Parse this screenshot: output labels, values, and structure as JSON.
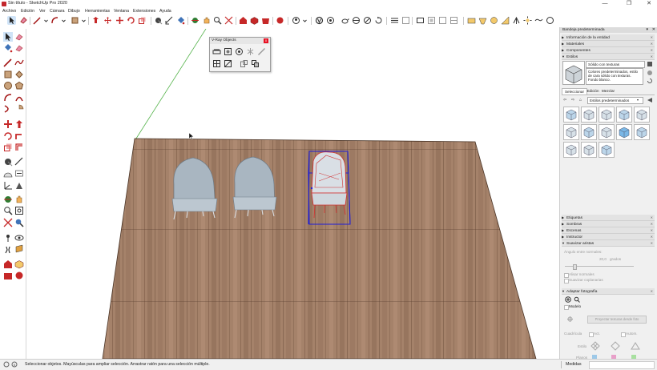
{
  "window": {
    "title": "Sin título - SketchUp Pro 2020",
    "controls": [
      "—",
      "❐",
      "✕"
    ]
  },
  "menu": [
    "Archivo",
    "Edición",
    "Ver",
    "Cámara",
    "Dibujo",
    "Herramientas",
    "Ventana",
    "Extensiones",
    "Ayuda"
  ],
  "vray_panel": {
    "title": "V-Ray Objects",
    "close": "x"
  },
  "tray": {
    "title": "Bandeja predeterminada",
    "sections_top": [
      "Información de la entidad",
      "Materiales",
      "Componentes",
      "Estilos"
    ],
    "style": {
      "name": "Sólido con texturas",
      "description": "Colores predeterminados, estilo de cara sólido con texturas. Fondo blanco."
    },
    "tabs": [
      "Seleccionar",
      "Edición",
      "Mezclar"
    ],
    "collection": "Estilos predeterminados",
    "sections_bottom": [
      "Etiquetas",
      "Sombras",
      "Escenas",
      "Instructor",
      "Suavizar aristas"
    ],
    "smooth": {
      "angle_label": "Ángulo entre normales:",
      "angle_value": "20,0",
      "angle_unit": "grados",
      "check1": "Alisar normales",
      "check2": "Suavizar coplanarias"
    },
    "photo": {
      "title": "Adaptar fotografía",
      "model_label": "Modelo",
      "project_button": "Proyectar texturas desde foto",
      "grid_label": "Cuadrícula",
      "act_label": "Act.",
      "auto_label": "Autom.",
      "style_label": "Estilo",
      "planes_label": "Planos"
    }
  },
  "status": {
    "message": "Seleccionar objetos. Mayúsculas para ampliar selección. Arrastrar ratón para una selección múltiple.",
    "measures_label": "Medidas"
  },
  "colors": {
    "floor_main": "#a5826a",
    "floor_dark": "#7d5c46",
    "selection_box": "#1f1fd8",
    "chair": "#a9b6c1",
    "axis_green": "#55b34b"
  }
}
